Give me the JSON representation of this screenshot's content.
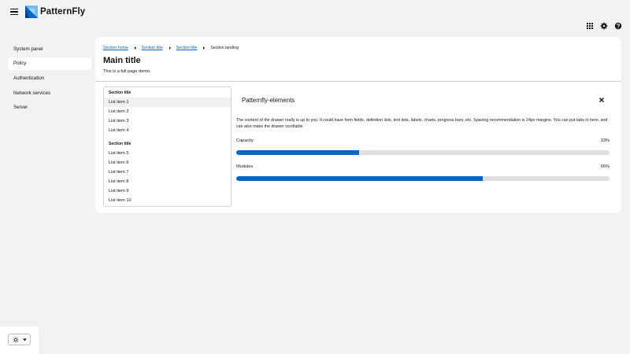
{
  "brand": {
    "name": "PatternFly"
  },
  "header": {
    "icons": [
      "grid-icon",
      "gear-icon",
      "help-icon"
    ]
  },
  "sidebar": {
    "items": [
      {
        "label": "System panel",
        "active": false
      },
      {
        "label": "Policy",
        "active": true
      },
      {
        "label": "Authentication",
        "active": false
      },
      {
        "label": "Network services",
        "active": false
      },
      {
        "label": "Server",
        "active": false
      }
    ]
  },
  "breadcrumb": {
    "items": [
      "Section home",
      "Section title",
      "Section title"
    ],
    "current": "Section landing"
  },
  "page": {
    "title": "Main title",
    "description": "This is a full page demo."
  },
  "menu": {
    "groups": [
      {
        "title": "Section title",
        "items": [
          "List item 1",
          "List item 2",
          "List item 3",
          "List item 4"
        ]
      },
      {
        "title": "Section title",
        "items": [
          "List item 5",
          "List item 6",
          "List item 7",
          "List item 8",
          "List item 9",
          "List item 10"
        ]
      }
    ],
    "selected": "List item 1"
  },
  "drawer": {
    "title": "Patternfly-elements",
    "body": "The content of the drawer really is up to you. It could have form fields, definition lists, text lists, labels, charts, progress bars, etc. Spacing recommendation is 24px margins. You can put tabs in here, and can also make the drawer scrollable.",
    "progress": [
      {
        "label": "Capacity",
        "value_text": "33%",
        "value": 0.33
      },
      {
        "label": "Modules",
        "value_text": "66%",
        "value": 0.66
      }
    ]
  },
  "colors": {
    "accent": "#0066cc",
    "brand_light": "#73bcf7",
    "background": "#f2f2f2"
  }
}
